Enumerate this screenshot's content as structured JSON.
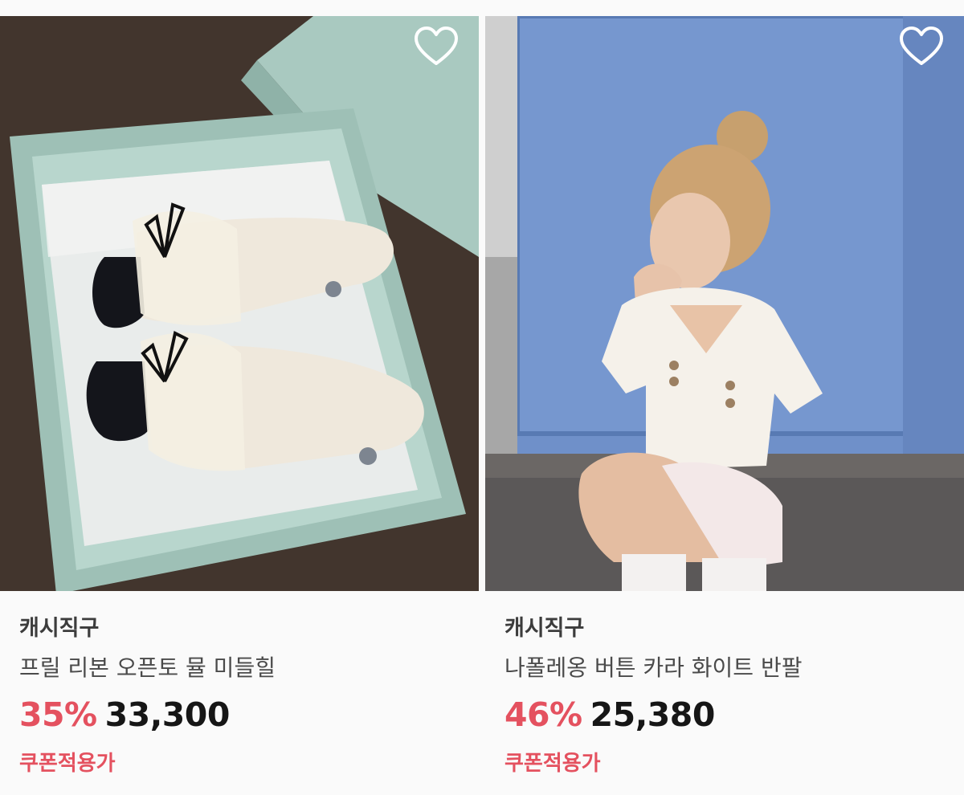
{
  "products": [
    {
      "brand": "캐시직구",
      "title": "프릴 리본 오픈토 뮬 미들힐",
      "discount": "35%",
      "price": "33,300",
      "coupon_label": "쿠폰적용가",
      "wishlist_icon": "heart-outline-icon"
    },
    {
      "brand": "캐시직구",
      "title": "나폴레옹 버튼 카라 화이트 반팔",
      "discount": "46%",
      "price": "25,380",
      "coupon_label": "쿠폰적용가",
      "wishlist_icon": "heart-outline-icon"
    }
  ],
  "colors": {
    "accent": "#e4515f",
    "background": "#fafafa"
  }
}
